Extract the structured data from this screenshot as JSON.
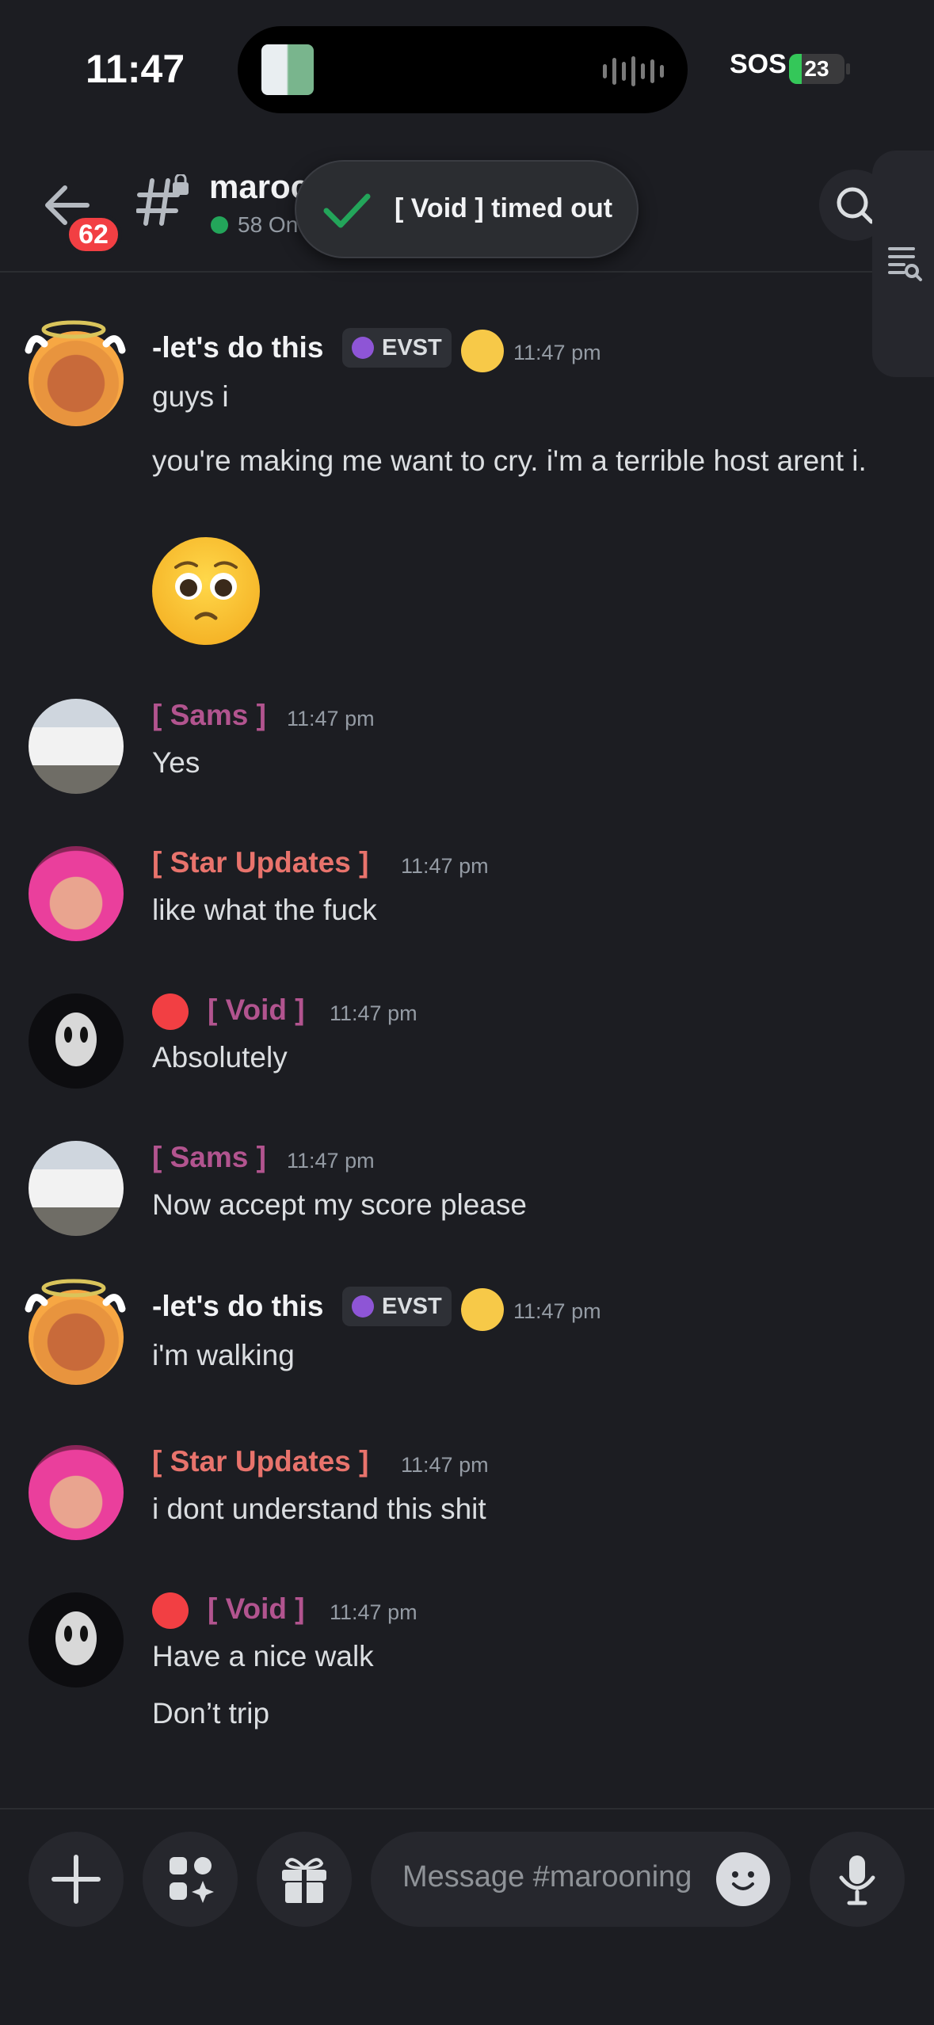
{
  "status_bar": {
    "time": "11:47",
    "sos": "SOS",
    "battery": "23",
    "battery_level": 0.23
  },
  "header": {
    "unread_count": "62",
    "channel_name": "maroc",
    "online_text": "58 On",
    "toast": "[ Void ] timed out"
  },
  "messages": [
    {
      "user": "-let's do this",
      "user_color": "#f2f3f5",
      "tag": "EVST",
      "time": "11:47 pm",
      "lines": [
        "guys i",
        "you're making me want to cry. i'm a terrible host arent i."
      ],
      "emoji": "pleading-face"
    },
    {
      "user": "[ Sams ]",
      "user_color": "#b2548f",
      "time": "11:47 pm",
      "lines": [
        "Yes"
      ]
    },
    {
      "user": "[ Star Updates ]",
      "user_color": "#e8736c",
      "time": "11:47 pm",
      "lines": [
        "like what the fuck"
      ]
    },
    {
      "user": "[ Void ]",
      "user_color": "#b2548f",
      "time": "11:47 pm",
      "lines": [
        "Absolutely"
      ]
    },
    {
      "user": "[ Sams ]",
      "user_color": "#b2548f",
      "time": "11:47 pm",
      "lines": [
        "Now accept my score please"
      ]
    },
    {
      "user": "-let's do this",
      "user_color": "#f2f3f5",
      "tag": "EVST",
      "time": "11:47 pm",
      "lines": [
        "i'm walking"
      ]
    },
    {
      "user": "[ Star Updates ]",
      "user_color": "#e8736c",
      "time": "11:47 pm",
      "lines": [
        "i dont understand this shit"
      ]
    },
    {
      "user": "[ Void ]",
      "user_color": "#b2548f",
      "time": "11:47 pm",
      "lines": [
        "Have a nice walk",
        "Don’t trip"
      ]
    }
  ],
  "composer": {
    "placeholder": "Message #marooning"
  }
}
